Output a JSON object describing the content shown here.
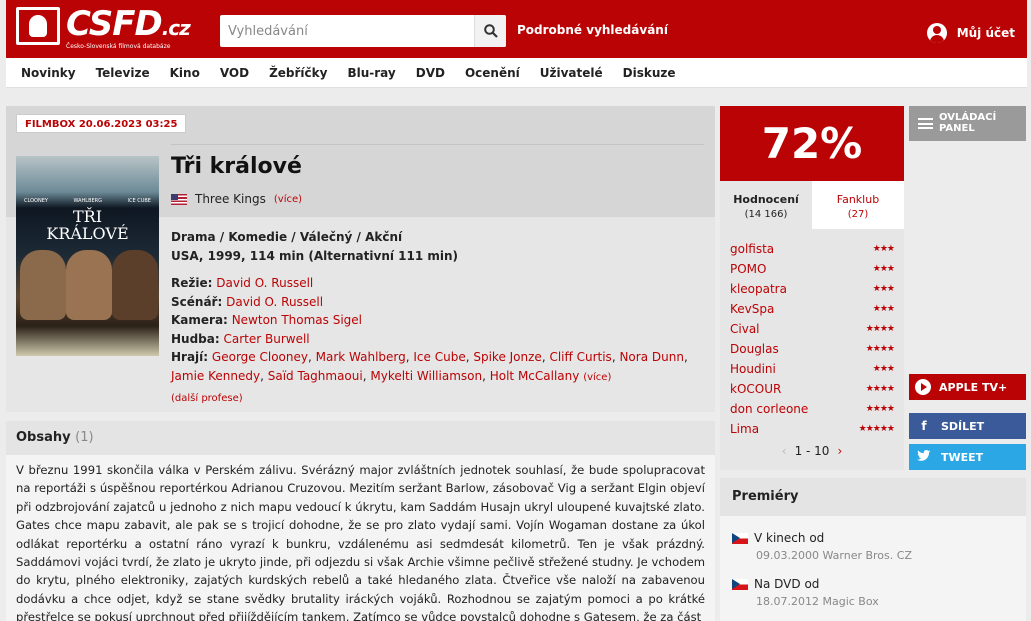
{
  "header": {
    "logo_text": "CSFD",
    "logo_tld": ".cz",
    "logo_subtitle": "Česko-Slovenská filmová databáze",
    "search_placeholder": "Vyhledávání",
    "advanced_search": "Podrobné vyhledávání",
    "account": "Můj účet"
  },
  "nav": [
    "Novinky",
    "Televize",
    "Kino",
    "VOD",
    "Žebříčky",
    "Blu-ray",
    "DVD",
    "Ocenění",
    "Uživatelé",
    "Diskuze"
  ],
  "film": {
    "tv_badge": "FILMBOX 20.06.2023 03:25",
    "title": "Tři králové",
    "original_title": "Three Kings",
    "more": "(více)",
    "genres": "Drama / Komedie / Válečný / Akční",
    "origin": "USA, 1999, 114 min (Alternativní 111 min)",
    "poster": {
      "names": [
        "CLOONEY",
        "WAHLBERG",
        "ICE CUBE"
      ],
      "title_line1": "TŘI",
      "title_line2": "KRÁLOVÉ"
    },
    "direction_label": "Režie:",
    "direction": "David O. Russell",
    "writer_label": "Scénář:",
    "writer": "David O. Russell",
    "camera_label": "Kamera:",
    "camera": "Newton Thomas Sigel",
    "music_label": "Hudba:",
    "music": "Carter Burwell",
    "cast_label": "Hrají:",
    "cast": [
      "George Clooney",
      "Mark Wahlberg",
      "Ice Cube",
      "Spike Jonze",
      "Cliff Curtis",
      "Nora Dunn",
      "Jamie Kennedy",
      "Saïd Taghmaoui",
      "Mykelti Williamson",
      "Holt McCallany"
    ],
    "cast_more": "(více)",
    "other_professions": "(další profese)"
  },
  "plot": {
    "heading": "Obsahy",
    "count": "(1)",
    "text": "V březnu 1991 skončila válka v Perském zálivu. Svérázný major zvláštních jednotek souhlasí, že bude spolupracovat na reportáži s úspěšnou reportérkou Adrianou Cruzovou. Mezitím seržant Barlow, zásobovač Vig a seržant Elgin objeví při odzbrojování zajatců u jednoho z nich mapu vedoucí k úkrytu, kam Saddám Husajn ukryl uloupené kuvajtské zlato. Gates chce mapu zabavit, ale pak se s trojicí dohodne, že se pro zlato vydají sami. Vojín Wogaman dostane za úkol odlákat reportérku a ostatní ráno vyrazí k bunkru, vzdálenému asi sedmdesát kilometrů. Ten je však prázdný. Saddámovi vojáci tvrdí, že zlato je ukryto jinde, při odjezdu si však Archie všimne pečlivě střežené studny. Je vchodem do krytu, plného elektroniky, zajatých kurdských rebelů a také hledaného zlata. Čtveřice vše naloží na zabavenou dodávku a chce odjet, když se stane svědky brutality iráckých vojáků. Rozhodnou se zajatým pomoci a po krátké přestřelce se pokusí uprchnout před přijíždějícím tankem. Zatímco se vůdce povstalců dohodne s Gatesem, že za část"
  },
  "rating": {
    "percent": "72%",
    "tab_ratings": "Hodnocení",
    "tab_ratings_count": "(14 166)",
    "tab_fanclub": "Fanklub",
    "tab_fanclub_count": "(27)",
    "accent_color": "#ba0305",
    "users": [
      {
        "name": "golfista",
        "stars": 3
      },
      {
        "name": "POMO",
        "stars": 3
      },
      {
        "name": "kleopatra",
        "stars": 3
      },
      {
        "name": "KevSpa",
        "stars": 3
      },
      {
        "name": "Cival",
        "stars": 4
      },
      {
        "name": "Douglas",
        "stars": 4
      },
      {
        "name": "Houdini",
        "stars": 3
      },
      {
        "name": "kOCOUR",
        "stars": 4
      },
      {
        "name": "don corleone",
        "stars": 4
      },
      {
        "name": "Lima",
        "stars": 5
      }
    ],
    "pager": "1 - 10"
  },
  "side": {
    "control_panel_line1": "OVLÁDACÍ",
    "control_panel_line2": "PANEL",
    "apple_tv": "APPLE TV+",
    "share": "SDÍLET",
    "tweet": "TWEET"
  },
  "premieres": {
    "heading": "Premiéry",
    "items": [
      {
        "label": "V kinech od",
        "detail": "09.03.2000 Warner Bros. CZ"
      },
      {
        "label": "Na DVD od",
        "detail": "18.07.2012 Magic Box"
      }
    ]
  }
}
